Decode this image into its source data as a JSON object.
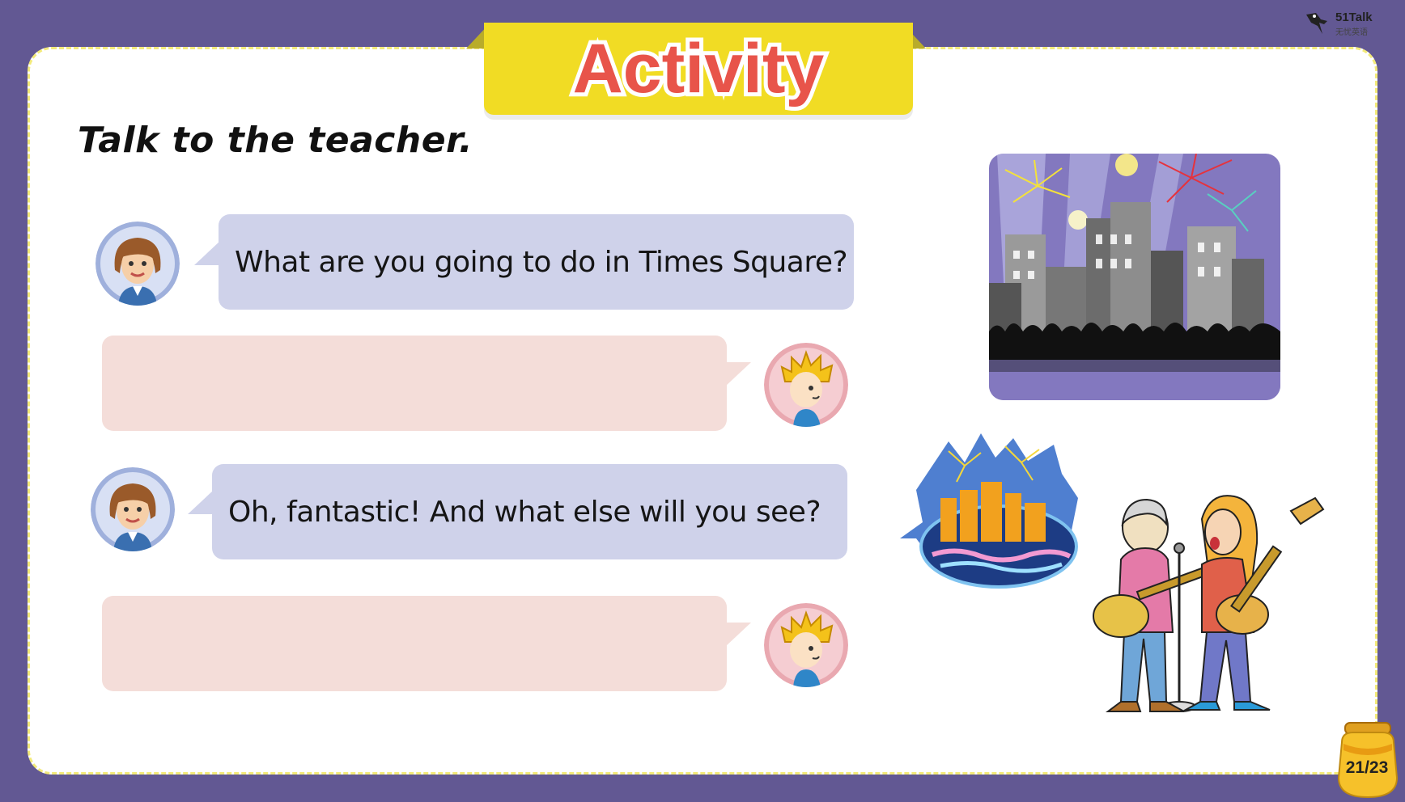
{
  "banner": {
    "title": "Activity"
  },
  "logo": {
    "name": "51Talk",
    "sub": "无忧英语"
  },
  "instruction": "Talk to the teacher.",
  "dialogue": [
    {
      "speaker": "teacher",
      "text": "What are you going to do in Times Square?"
    },
    {
      "speaker": "student",
      "text": ""
    },
    {
      "speaker": "teacher",
      "text": "Oh, fantastic! And what else will you see?"
    },
    {
      "speaker": "student",
      "text": ""
    }
  ],
  "page": {
    "indicator": "21/23"
  },
  "colors": {
    "background": "#625893",
    "banner": "#f1dc24",
    "title": "#e8544a",
    "teacher_bubble": "#cfd2ea",
    "student_bubble": "#f4ddd9"
  },
  "icons": {
    "teacher_avatar": "teacher-avatar",
    "student_avatar": "student-avatar",
    "honey_jar": "honey-jar-icon"
  }
}
